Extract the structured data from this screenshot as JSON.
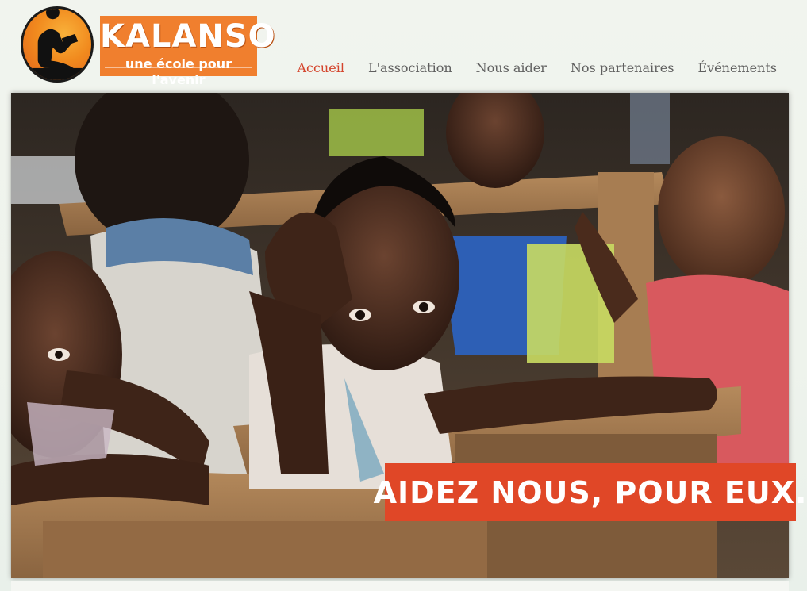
{
  "brand": {
    "name": "KALANSO",
    "tagline": "une école pour l'avenir",
    "logo_icon": "reading-child-silhouette-icon"
  },
  "nav": {
    "items": [
      {
        "label": "Accueil",
        "active": true
      },
      {
        "label": "L'association",
        "active": false
      },
      {
        "label": "Nous aider",
        "active": false
      },
      {
        "label": "Nos partenaires",
        "active": false
      },
      {
        "label": "Événements",
        "active": false
      }
    ]
  },
  "hero": {
    "image_subject": "children-at-wooden-school-desks-photo",
    "banner_text": "AIDEZ NOUS, POUR EUX."
  },
  "colors": {
    "accent": "#e04727",
    "nav_active": "#d4442c",
    "nav_text": "#5f5f5f",
    "brand_orange": "#f07f2e"
  }
}
